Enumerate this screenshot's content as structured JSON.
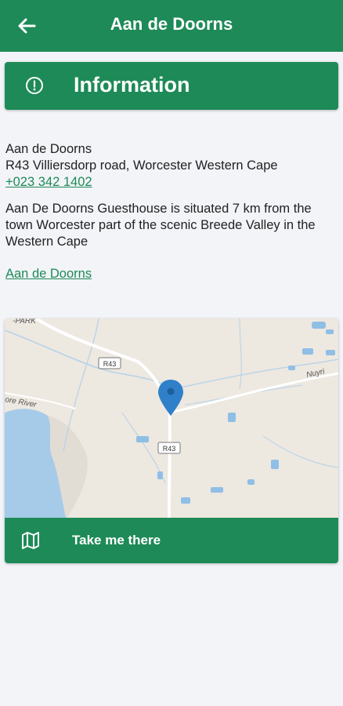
{
  "appbar": {
    "title": "Aan de Doorns",
    "back_icon": "arrow-left-icon"
  },
  "info_header": {
    "label": "Information",
    "icon": "info-circle-icon"
  },
  "details": {
    "name": "Aan de Doorns",
    "address": "R43 Villiersdorp road, Worcester Western Cape",
    "phone": "+023 342 1402",
    "description": "Aan De Doorns Guesthouse is situated 7 km from the town Worcester part of the scenic Breede Valley in the Western Cape",
    "website_link": "Aan de Doorns"
  },
  "map": {
    "road_label_top": "R43",
    "road_label_bottom": "R43",
    "place_label_top_left": "-PARK",
    "place_label_river": "ore River",
    "place_label_right": "Nuyri",
    "pin_color": "#2f80c9"
  },
  "cta": {
    "label": "Take me there",
    "icon": "map-icon"
  },
  "colors": {
    "primary": "#1e8a57",
    "background": "#f2f4f8",
    "link": "#1e8a57"
  }
}
